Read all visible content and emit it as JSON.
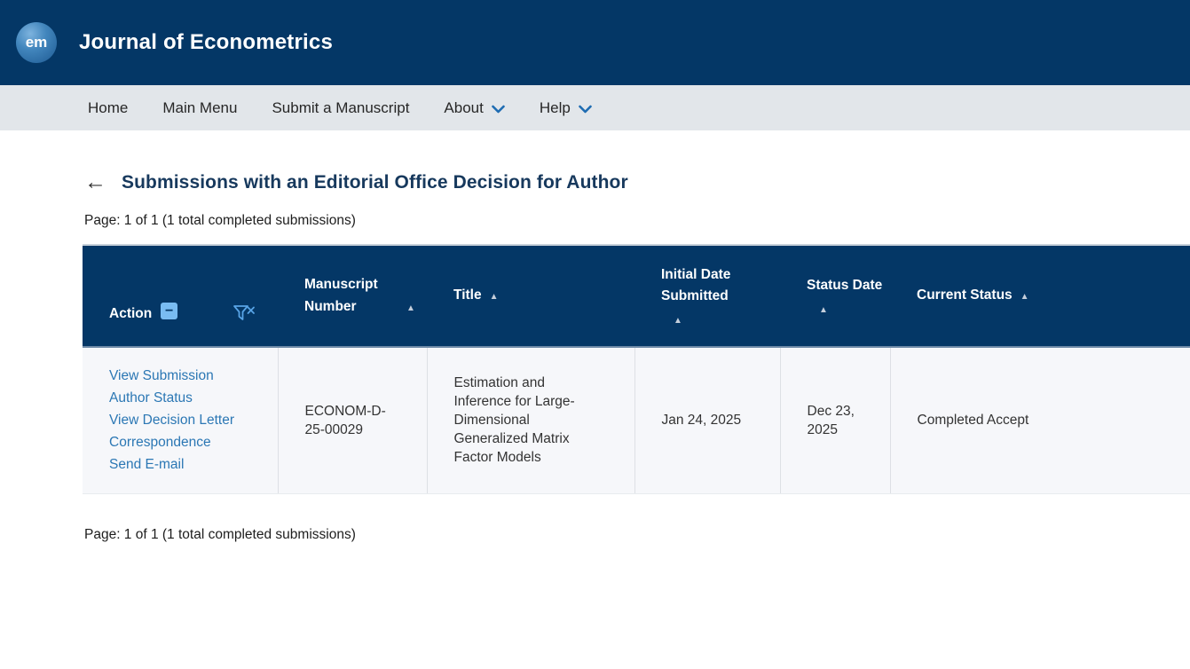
{
  "colors": {
    "banner_navy": "#043766",
    "nav_gray": "#e2e6ea",
    "link_blue": "#2b77b4",
    "icon_light_blue": "#79bcf2",
    "heading_navy": "#17395d"
  },
  "icons": {
    "back_arrow": "←",
    "sort_asc": "▲",
    "collapse_minus": "−"
  },
  "banner": {
    "logo_text": "em",
    "journal_title": "Journal of Econometrics"
  },
  "nav": {
    "items": [
      {
        "label": "Home"
      },
      {
        "label": "Main Menu"
      },
      {
        "label": "Submit a Manuscript"
      },
      {
        "label": "About",
        "dropdown": true
      },
      {
        "label": "Help",
        "dropdown": true
      }
    ]
  },
  "page": {
    "title": "Submissions with an Editorial Office Decision for Author",
    "pagination_top": "Page: 1 of 1 (1 total completed submissions)",
    "pagination_bottom": "Page: 1 of 1 (1 total completed submissions)"
  },
  "table": {
    "columns": [
      "Action",
      "Manuscript Number",
      "Title",
      "Initial Date Submitted",
      "Status Date",
      "Current Status"
    ],
    "rows": [
      {
        "actions": [
          "View Submission",
          "Author Status",
          "View Decision Letter",
          "Correspondence",
          "Send E-mail"
        ],
        "manuscript_number": "ECONOM-D-25-00029",
        "title": "Estimation and Inference for Large-Dimensional Generalized Matrix Factor Models",
        "initial_date_submitted": "Jan 24, 2025",
        "status_date": "Dec 23, 2025",
        "current_status": "Completed Accept"
      }
    ]
  }
}
